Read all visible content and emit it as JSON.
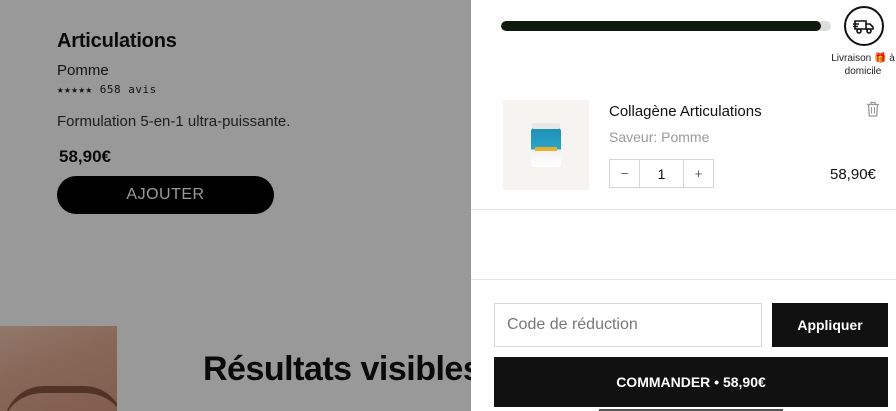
{
  "product": {
    "title": "Articulations",
    "flavor": "Pomme",
    "rating": "★★★★★ 658 avis",
    "description": "Formulation 5-en-1 ultra-puissante.",
    "price": "58,90€",
    "add_label": "AJOUTER"
  },
  "section": {
    "title": "Résultats visibles"
  },
  "cart": {
    "shipping_progress": 0.97,
    "shipping_label": "Livraison 🎁 à domicile",
    "item": {
      "name": "Collagène Articulations",
      "variant": "Saveur: Pomme",
      "quantity": "1",
      "decrement": "−",
      "increment": "+",
      "price": "58,90€"
    },
    "discount": {
      "placeholder": "Code de réduction",
      "apply_label": "Appliquer"
    },
    "checkout_label": "COMMANDER • 58,90€"
  },
  "colors": {
    "progress_fill": "#0f1a0f",
    "button_dark": "#111111",
    "overlay": "rgba(0,0,0,0.4)"
  }
}
